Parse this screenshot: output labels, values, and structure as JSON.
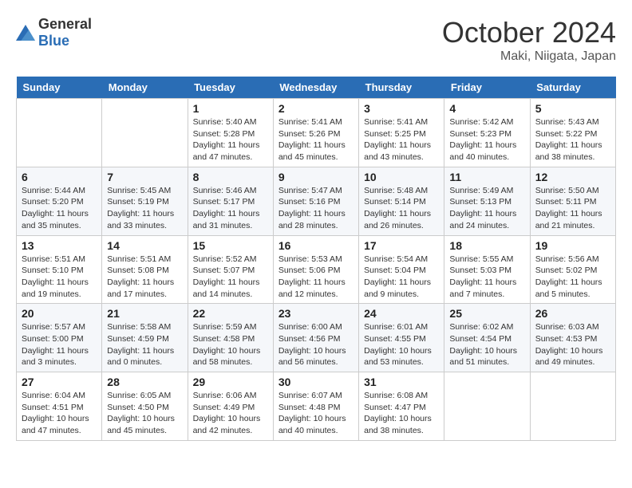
{
  "header": {
    "logo": {
      "general": "General",
      "blue": "Blue"
    },
    "title": "October 2024",
    "location": "Maki, Niigata, Japan"
  },
  "calendar": {
    "days_of_week": [
      "Sunday",
      "Monday",
      "Tuesday",
      "Wednesday",
      "Thursday",
      "Friday",
      "Saturday"
    ],
    "weeks": [
      [
        {
          "day": "",
          "info": ""
        },
        {
          "day": "",
          "info": ""
        },
        {
          "day": "1",
          "info": "Sunrise: 5:40 AM\nSunset: 5:28 PM\nDaylight: 11 hours and 47 minutes."
        },
        {
          "day": "2",
          "info": "Sunrise: 5:41 AM\nSunset: 5:26 PM\nDaylight: 11 hours and 45 minutes."
        },
        {
          "day": "3",
          "info": "Sunrise: 5:41 AM\nSunset: 5:25 PM\nDaylight: 11 hours and 43 minutes."
        },
        {
          "day": "4",
          "info": "Sunrise: 5:42 AM\nSunset: 5:23 PM\nDaylight: 11 hours and 40 minutes."
        },
        {
          "day": "5",
          "info": "Sunrise: 5:43 AM\nSunset: 5:22 PM\nDaylight: 11 hours and 38 minutes."
        }
      ],
      [
        {
          "day": "6",
          "info": "Sunrise: 5:44 AM\nSunset: 5:20 PM\nDaylight: 11 hours and 35 minutes."
        },
        {
          "day": "7",
          "info": "Sunrise: 5:45 AM\nSunset: 5:19 PM\nDaylight: 11 hours and 33 minutes."
        },
        {
          "day": "8",
          "info": "Sunrise: 5:46 AM\nSunset: 5:17 PM\nDaylight: 11 hours and 31 minutes."
        },
        {
          "day": "9",
          "info": "Sunrise: 5:47 AM\nSunset: 5:16 PM\nDaylight: 11 hours and 28 minutes."
        },
        {
          "day": "10",
          "info": "Sunrise: 5:48 AM\nSunset: 5:14 PM\nDaylight: 11 hours and 26 minutes."
        },
        {
          "day": "11",
          "info": "Sunrise: 5:49 AM\nSunset: 5:13 PM\nDaylight: 11 hours and 24 minutes."
        },
        {
          "day": "12",
          "info": "Sunrise: 5:50 AM\nSunset: 5:11 PM\nDaylight: 11 hours and 21 minutes."
        }
      ],
      [
        {
          "day": "13",
          "info": "Sunrise: 5:51 AM\nSunset: 5:10 PM\nDaylight: 11 hours and 19 minutes."
        },
        {
          "day": "14",
          "info": "Sunrise: 5:51 AM\nSunset: 5:08 PM\nDaylight: 11 hours and 17 minutes."
        },
        {
          "day": "15",
          "info": "Sunrise: 5:52 AM\nSunset: 5:07 PM\nDaylight: 11 hours and 14 minutes."
        },
        {
          "day": "16",
          "info": "Sunrise: 5:53 AM\nSunset: 5:06 PM\nDaylight: 11 hours and 12 minutes."
        },
        {
          "day": "17",
          "info": "Sunrise: 5:54 AM\nSunset: 5:04 PM\nDaylight: 11 hours and 9 minutes."
        },
        {
          "day": "18",
          "info": "Sunrise: 5:55 AM\nSunset: 5:03 PM\nDaylight: 11 hours and 7 minutes."
        },
        {
          "day": "19",
          "info": "Sunrise: 5:56 AM\nSunset: 5:02 PM\nDaylight: 11 hours and 5 minutes."
        }
      ],
      [
        {
          "day": "20",
          "info": "Sunrise: 5:57 AM\nSunset: 5:00 PM\nDaylight: 11 hours and 3 minutes."
        },
        {
          "day": "21",
          "info": "Sunrise: 5:58 AM\nSunset: 4:59 PM\nDaylight: 11 hours and 0 minutes."
        },
        {
          "day": "22",
          "info": "Sunrise: 5:59 AM\nSunset: 4:58 PM\nDaylight: 10 hours and 58 minutes."
        },
        {
          "day": "23",
          "info": "Sunrise: 6:00 AM\nSunset: 4:56 PM\nDaylight: 10 hours and 56 minutes."
        },
        {
          "day": "24",
          "info": "Sunrise: 6:01 AM\nSunset: 4:55 PM\nDaylight: 10 hours and 53 minutes."
        },
        {
          "day": "25",
          "info": "Sunrise: 6:02 AM\nSunset: 4:54 PM\nDaylight: 10 hours and 51 minutes."
        },
        {
          "day": "26",
          "info": "Sunrise: 6:03 AM\nSunset: 4:53 PM\nDaylight: 10 hours and 49 minutes."
        }
      ],
      [
        {
          "day": "27",
          "info": "Sunrise: 6:04 AM\nSunset: 4:51 PM\nDaylight: 10 hours and 47 minutes."
        },
        {
          "day": "28",
          "info": "Sunrise: 6:05 AM\nSunset: 4:50 PM\nDaylight: 10 hours and 45 minutes."
        },
        {
          "day": "29",
          "info": "Sunrise: 6:06 AM\nSunset: 4:49 PM\nDaylight: 10 hours and 42 minutes."
        },
        {
          "day": "30",
          "info": "Sunrise: 6:07 AM\nSunset: 4:48 PM\nDaylight: 10 hours and 40 minutes."
        },
        {
          "day": "31",
          "info": "Sunrise: 6:08 AM\nSunset: 4:47 PM\nDaylight: 10 hours and 38 minutes."
        },
        {
          "day": "",
          "info": ""
        },
        {
          "day": "",
          "info": ""
        }
      ]
    ]
  }
}
